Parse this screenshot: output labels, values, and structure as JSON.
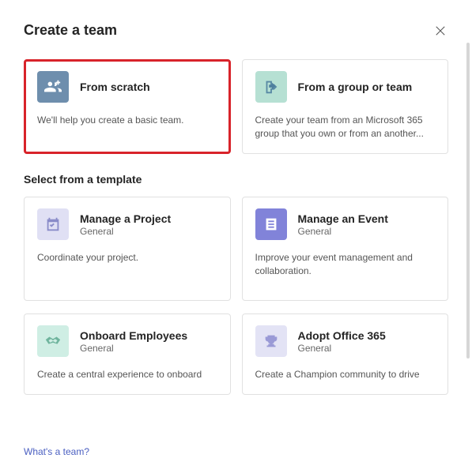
{
  "header": {
    "title": "Create a team"
  },
  "primary_options": [
    {
      "key": "from-scratch",
      "title": "From scratch",
      "desc": "We'll help you create a basic team.",
      "icon": "team-icon",
      "bg": "#6e8ead",
      "fg": "#ffffff",
      "highlight": true
    },
    {
      "key": "from-group",
      "title": "From a group or team",
      "desc": "Create your team from an Microsoft 365 group that you own or from an another...",
      "icon": "share-arrow-icon",
      "bg": "#b6e0d3",
      "fg": "#4e7f9e",
      "highlight": false
    }
  ],
  "template_section_title": "Select from a template",
  "templates": [
    {
      "key": "manage-project",
      "title": "Manage a Project",
      "sub": "General",
      "desc": "Coordinate your project.",
      "icon": "calendar-check-icon",
      "bg": "#e0e0f4",
      "fg": "#8a8cc9"
    },
    {
      "key": "manage-event",
      "title": "Manage an Event",
      "sub": "General",
      "desc": "Improve your event management and collaboration.",
      "icon": "checklist-icon",
      "bg": "#8183d9",
      "fg": "#ffffff"
    },
    {
      "key": "onboard-employees",
      "title": "Onboard Employees",
      "sub": "General",
      "desc": "Create a central experience to onboard",
      "icon": "handshake-icon",
      "bg": "#cfeee4",
      "fg": "#6fb49d"
    },
    {
      "key": "adopt-office-365",
      "title": "Adopt Office 365",
      "sub": "General",
      "desc": "Create a Champion community to drive",
      "icon": "trophy-icon",
      "bg": "#e3e3f5",
      "fg": "#9a9ad6"
    }
  ],
  "footer": {
    "link": "What's a team?"
  }
}
